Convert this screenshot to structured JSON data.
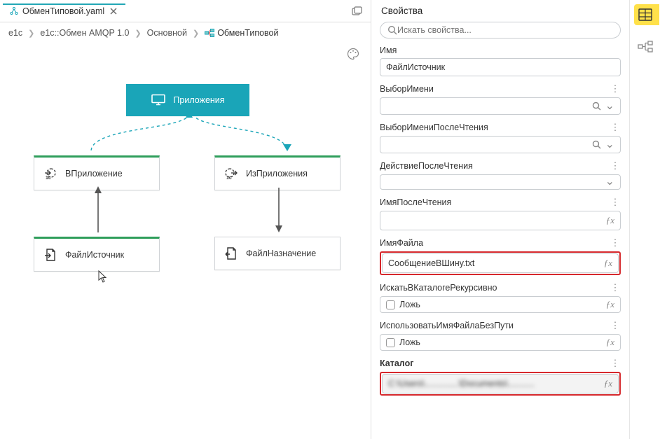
{
  "tab": {
    "filename": "ОбменТиповой.yaml"
  },
  "breadcrumb": {
    "items": [
      "e1c",
      "e1c::Обмен AMQP 1.0",
      "Основной"
    ],
    "current": "ОбменТиповой"
  },
  "canvas": {
    "nodes": {
      "apps": {
        "label": "Приложения"
      },
      "in_app": {
        "label": "ВПриложение"
      },
      "out_app": {
        "label": "ИзПриложения"
      },
      "file_src": {
        "label": "ФайлИсточник"
      },
      "file_dst": {
        "label": "ФайлНазначение"
      }
    }
  },
  "props": {
    "title": "Свойства",
    "search_ph": "Искать свойства...",
    "name_label": "Имя",
    "name_value": "ФайлИсточник",
    "label_vybor": "ВыборИмени",
    "label_vybor_posle": "ВыборИмениПослеЧтения",
    "label_deystvie": "ДействиеПослеЧтения",
    "label_imya_posle": "ИмяПослеЧтения",
    "label_imya_fayla": "ИмяФайла",
    "value_imya_fayla": "СообщениеВШину.txt",
    "label_rekursiv": "ИскатьВКаталогеРекурсивно",
    "value_lozh": "Ложь",
    "label_bezputi": "ИспользоватьИмяФайлаБезПути",
    "label_katalog": "Каталог",
    "value_katalog_blurred": "C:\\Users\\..............\\Documents\\..........."
  },
  "icons": {
    "more_vert": "⋮",
    "chevron_down": "⌄",
    "search": "search",
    "fx": "ƒx"
  }
}
